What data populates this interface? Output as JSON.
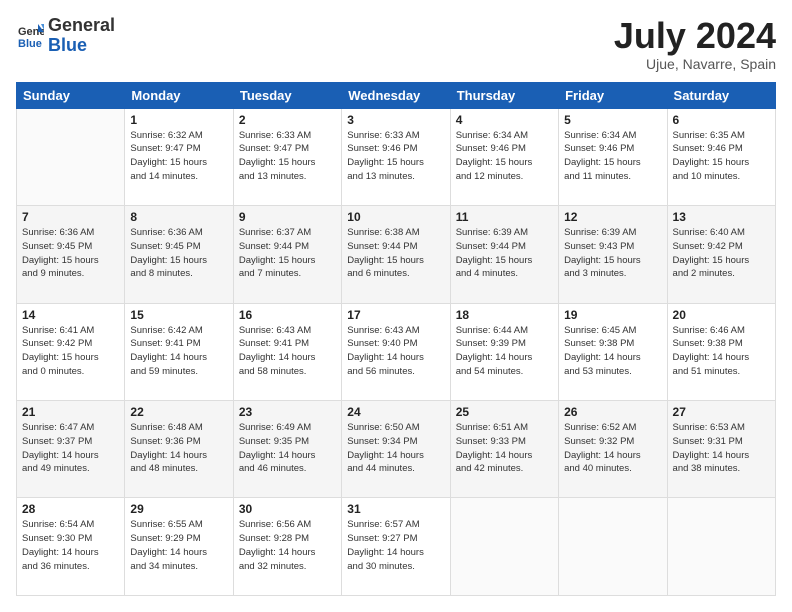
{
  "header": {
    "logo_general": "General",
    "logo_blue": "Blue",
    "title": "July 2024",
    "subtitle": "Ujue, Navarre, Spain"
  },
  "weekdays": [
    "Sunday",
    "Monday",
    "Tuesday",
    "Wednesday",
    "Thursday",
    "Friday",
    "Saturday"
  ],
  "weeks": [
    [
      {
        "day": "",
        "info": ""
      },
      {
        "day": "1",
        "info": "Sunrise: 6:32 AM\nSunset: 9:47 PM\nDaylight: 15 hours\nand 14 minutes."
      },
      {
        "day": "2",
        "info": "Sunrise: 6:33 AM\nSunset: 9:47 PM\nDaylight: 15 hours\nand 13 minutes."
      },
      {
        "day": "3",
        "info": "Sunrise: 6:33 AM\nSunset: 9:46 PM\nDaylight: 15 hours\nand 13 minutes."
      },
      {
        "day": "4",
        "info": "Sunrise: 6:34 AM\nSunset: 9:46 PM\nDaylight: 15 hours\nand 12 minutes."
      },
      {
        "day": "5",
        "info": "Sunrise: 6:34 AM\nSunset: 9:46 PM\nDaylight: 15 hours\nand 11 minutes."
      },
      {
        "day": "6",
        "info": "Sunrise: 6:35 AM\nSunset: 9:46 PM\nDaylight: 15 hours\nand 10 minutes."
      }
    ],
    [
      {
        "day": "7",
        "info": "Sunrise: 6:36 AM\nSunset: 9:45 PM\nDaylight: 15 hours\nand 9 minutes."
      },
      {
        "day": "8",
        "info": "Sunrise: 6:36 AM\nSunset: 9:45 PM\nDaylight: 15 hours\nand 8 minutes."
      },
      {
        "day": "9",
        "info": "Sunrise: 6:37 AM\nSunset: 9:44 PM\nDaylight: 15 hours\nand 7 minutes."
      },
      {
        "day": "10",
        "info": "Sunrise: 6:38 AM\nSunset: 9:44 PM\nDaylight: 15 hours\nand 6 minutes."
      },
      {
        "day": "11",
        "info": "Sunrise: 6:39 AM\nSunset: 9:44 PM\nDaylight: 15 hours\nand 4 minutes."
      },
      {
        "day": "12",
        "info": "Sunrise: 6:39 AM\nSunset: 9:43 PM\nDaylight: 15 hours\nand 3 minutes."
      },
      {
        "day": "13",
        "info": "Sunrise: 6:40 AM\nSunset: 9:42 PM\nDaylight: 15 hours\nand 2 minutes."
      }
    ],
    [
      {
        "day": "14",
        "info": "Sunrise: 6:41 AM\nSunset: 9:42 PM\nDaylight: 15 hours\nand 0 minutes."
      },
      {
        "day": "15",
        "info": "Sunrise: 6:42 AM\nSunset: 9:41 PM\nDaylight: 14 hours\nand 59 minutes."
      },
      {
        "day": "16",
        "info": "Sunrise: 6:43 AM\nSunset: 9:41 PM\nDaylight: 14 hours\nand 58 minutes."
      },
      {
        "day": "17",
        "info": "Sunrise: 6:43 AM\nSunset: 9:40 PM\nDaylight: 14 hours\nand 56 minutes."
      },
      {
        "day": "18",
        "info": "Sunrise: 6:44 AM\nSunset: 9:39 PM\nDaylight: 14 hours\nand 54 minutes."
      },
      {
        "day": "19",
        "info": "Sunrise: 6:45 AM\nSunset: 9:38 PM\nDaylight: 14 hours\nand 53 minutes."
      },
      {
        "day": "20",
        "info": "Sunrise: 6:46 AM\nSunset: 9:38 PM\nDaylight: 14 hours\nand 51 minutes."
      }
    ],
    [
      {
        "day": "21",
        "info": "Sunrise: 6:47 AM\nSunset: 9:37 PM\nDaylight: 14 hours\nand 49 minutes."
      },
      {
        "day": "22",
        "info": "Sunrise: 6:48 AM\nSunset: 9:36 PM\nDaylight: 14 hours\nand 48 minutes."
      },
      {
        "day": "23",
        "info": "Sunrise: 6:49 AM\nSunset: 9:35 PM\nDaylight: 14 hours\nand 46 minutes."
      },
      {
        "day": "24",
        "info": "Sunrise: 6:50 AM\nSunset: 9:34 PM\nDaylight: 14 hours\nand 44 minutes."
      },
      {
        "day": "25",
        "info": "Sunrise: 6:51 AM\nSunset: 9:33 PM\nDaylight: 14 hours\nand 42 minutes."
      },
      {
        "day": "26",
        "info": "Sunrise: 6:52 AM\nSunset: 9:32 PM\nDaylight: 14 hours\nand 40 minutes."
      },
      {
        "day": "27",
        "info": "Sunrise: 6:53 AM\nSunset: 9:31 PM\nDaylight: 14 hours\nand 38 minutes."
      }
    ],
    [
      {
        "day": "28",
        "info": "Sunrise: 6:54 AM\nSunset: 9:30 PM\nDaylight: 14 hours\nand 36 minutes."
      },
      {
        "day": "29",
        "info": "Sunrise: 6:55 AM\nSunset: 9:29 PM\nDaylight: 14 hours\nand 34 minutes."
      },
      {
        "day": "30",
        "info": "Sunrise: 6:56 AM\nSunset: 9:28 PM\nDaylight: 14 hours\nand 32 minutes."
      },
      {
        "day": "31",
        "info": "Sunrise: 6:57 AM\nSunset: 9:27 PM\nDaylight: 14 hours\nand 30 minutes."
      },
      {
        "day": "",
        "info": ""
      },
      {
        "day": "",
        "info": ""
      },
      {
        "day": "",
        "info": ""
      }
    ]
  ]
}
